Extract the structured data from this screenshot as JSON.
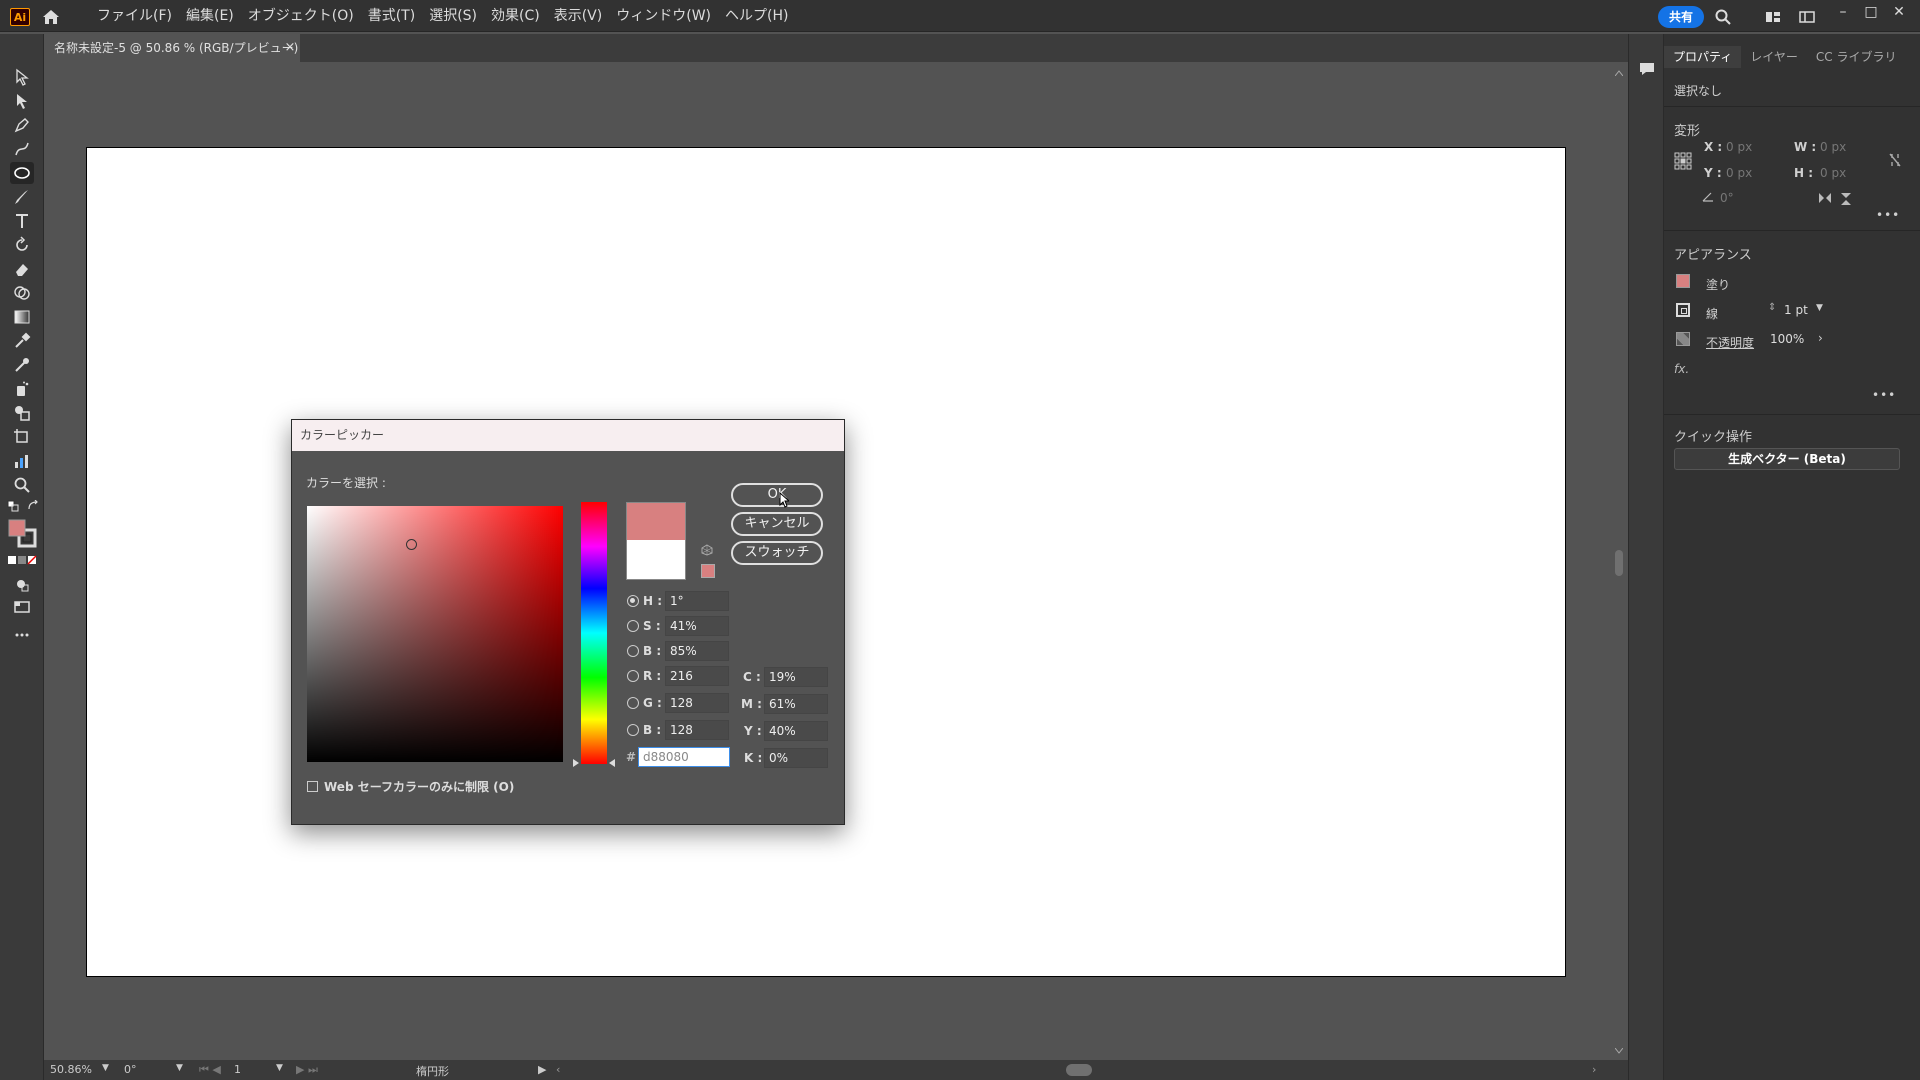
{
  "app": {
    "logo": "Ai"
  },
  "menu": [
    "ファイル(F)",
    "編集(E)",
    "オブジェクト(O)",
    "書式(T)",
    "選択(S)",
    "効果(C)",
    "表示(V)",
    "ウィンドウ(W)",
    "ヘルプ(H)"
  ],
  "topbar": {
    "share_label": "共有"
  },
  "document": {
    "tab_title": "名称未設定-5 @ 50.86 % (RGB/プレビュー)",
    "close_glyph": "×"
  },
  "status": {
    "zoom": "50.86%",
    "rotation": "0°",
    "page": "1",
    "tool_name": "楕円形"
  },
  "panel": {
    "tabs": [
      "プロパティ",
      "レイヤー",
      "CC ライブラリ"
    ],
    "no_selection": "選択なし",
    "transform": {
      "heading": "変形",
      "x_label": "X :",
      "x_value": "0 px",
      "y_label": "Y :",
      "y_value": "0 px",
      "w_label": "W :",
      "w_value": "0 px",
      "h_label": "H :",
      "h_value": "0 px",
      "angle_value": "0°"
    },
    "appearance": {
      "heading": "アピアランス",
      "fill_label": "塗り",
      "stroke_label": "線",
      "stroke_value": "1 pt",
      "opacity_label": "不透明度",
      "opacity_value": "100%",
      "fx_label": "fx."
    },
    "quick_actions": {
      "heading": "クイック操作",
      "generate_button": "生成ベクター (Beta)"
    }
  },
  "color_picker": {
    "title": "カラーピッカー",
    "select_label": "カラーを選択 :",
    "buttons": {
      "ok": "OK",
      "cancel": "キャンセル",
      "swatches": "スウォッチ"
    },
    "hsb": {
      "h_label": "H :",
      "h": "1°",
      "s_label": "S :",
      "s": "41%",
      "b_label": "B :",
      "b": "85%"
    },
    "rgb": {
      "r_label": "R :",
      "r": "216",
      "g_label": "G :",
      "g": "128",
      "b_label": "B :",
      "b": "128"
    },
    "cmyk": {
      "c_label": "C :",
      "c": "19%",
      "m_label": "M :",
      "m": "61%",
      "y_label": "Y :",
      "y": "40%",
      "k_label": "K :",
      "k": "0%"
    },
    "hex_symbol": "#",
    "hex": "d88080",
    "websafe_label": "Web セーフカラーのみに制限 (O)",
    "selected_color": "#d88080",
    "saturation": 0.41,
    "brightness": 0.85,
    "hue_fraction": 0.003
  }
}
